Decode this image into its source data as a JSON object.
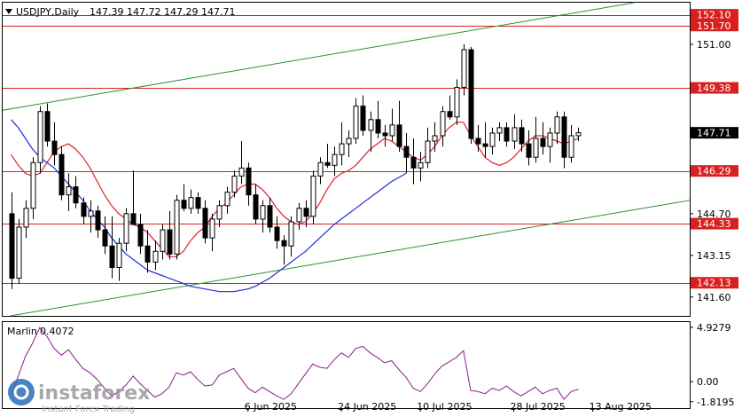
{
  "header": {
    "symbol": "USDJPY,Daily",
    "ohlc": "147.39 147.72 147.29 147.71"
  },
  "indicator": {
    "name": "Marlin",
    "value": "0.4072"
  },
  "watermark": {
    "brand": "instaforex",
    "tagline": "Instant Forex Trading"
  },
  "colors": {
    "bull_body": "#ffffff",
    "bear_body": "#000000",
    "candle_outline": "#000000",
    "ma_fast": "#e0202a",
    "ma_slow": "#1c2fd6",
    "channel": "#2f8f2f",
    "hline": "#d92020",
    "hlabel_bg": "#d92020",
    "osc": "#8b1f8b"
  },
  "chart_data": [
    {
      "type": "candlestick",
      "title": "USDJPY,Daily",
      "ylim": [
        140.9,
        152.55
      ],
      "y_ticks": [
        "151.00",
        "149.38",
        "147.71",
        "146.29",
        "144.70",
        "144.33",
        "143.15",
        "142.13",
        "141.60"
      ],
      "x_ticks": [
        "6 Jun 2025",
        "24 Jun 2025",
        "10 Jul 2025",
        "28 Jul 2025",
        "13 Aug 2025"
      ],
      "x_tick_bars": [
        33,
        46,
        57,
        70,
        81
      ],
      "price_label": "147.71",
      "horizontal_levels": [
        {
          "value": 152.1,
          "label": "152.10"
        },
        {
          "value": 151.7,
          "label": "151.70"
        },
        {
          "value": 149.38,
          "label": "149.38"
        },
        {
          "value": 146.29,
          "label": "146.29"
        },
        {
          "value": 144.33,
          "label": "144.33"
        },
        {
          "value": 142.13,
          "label": "142.13"
        }
      ],
      "channel_lines": [
        {
          "start": [
            0,
            148.6
          ],
          "end": [
            78,
            152.15
          ]
        },
        {
          "start": [
            12,
            141.45
          ],
          "end": [
            110,
            145.9
          ]
        }
      ],
      "candles": [
        [
          144.7,
          145.5,
          141.9,
          142.3
        ],
        [
          142.3,
          144.5,
          142.1,
          144.2
        ],
        [
          144.2,
          145.2,
          143.8,
          144.9
        ],
        [
          144.9,
          146.8,
          144.5,
          146.6
        ],
        [
          146.6,
          148.7,
          146.2,
          148.5
        ],
        [
          148.5,
          148.8,
          147.2,
          147.4
        ],
        [
          147.4,
          148.1,
          146.5,
          146.9
        ],
        [
          146.9,
          147.2,
          145.2,
          145.4
        ],
        [
          145.4,
          146.2,
          144.8,
          145.7
        ],
        [
          145.7,
          146.1,
          144.9,
          145.1
        ],
        [
          145.1,
          145.3,
          144.3,
          144.6
        ],
        [
          144.6,
          145.2,
          144.0,
          144.8
        ],
        [
          144.8,
          145.0,
          143.8,
          144.1
        ],
        [
          144.1,
          144.6,
          143.2,
          143.5
        ],
        [
          143.5,
          144.6,
          142.3,
          142.7
        ],
        [
          142.7,
          143.8,
          142.2,
          143.6
        ],
        [
          143.6,
          144.9,
          143.3,
          144.7
        ],
        [
          144.7,
          146.3,
          144.4,
          144.3
        ],
        [
          144.3,
          144.7,
          143.2,
          143.5
        ],
        [
          143.5,
          144.1,
          142.5,
          142.9
        ],
        [
          142.9,
          143.7,
          142.6,
          143.3
        ],
        [
          143.3,
          144.3,
          143.0,
          144.1
        ],
        [
          144.1,
          144.8,
          143.0,
          143.2
        ],
        [
          143.2,
          145.4,
          143.0,
          145.2
        ],
        [
          145.2,
          145.8,
          144.8,
          144.9
        ],
        [
          144.9,
          145.6,
          144.7,
          145.3
        ],
        [
          145.3,
          145.5,
          144.7,
          144.9
        ],
        [
          144.9,
          145.2,
          143.6,
          143.8
        ],
        [
          143.8,
          144.7,
          143.3,
          144.5
        ],
        [
          144.5,
          145.2,
          144.2,
          145.0
        ],
        [
          145.0,
          145.7,
          144.7,
          145.5
        ],
        [
          145.5,
          146.3,
          145.3,
          146.1
        ],
        [
          146.1,
          147.4,
          145.8,
          146.4
        ],
        [
          146.4,
          146.6,
          145.0,
          145.4
        ],
        [
          145.4,
          145.8,
          144.3,
          144.5
        ],
        [
          144.5,
          145.2,
          144.0,
          145.0
        ],
        [
          145.0,
          145.3,
          144.0,
          144.2
        ],
        [
          144.2,
          144.6,
          143.4,
          143.7
        ],
        [
          143.7,
          143.9,
          142.8,
          143.5
        ],
        [
          143.5,
          144.6,
          143.1,
          144.4
        ],
        [
          144.4,
          145.1,
          144.1,
          144.9
        ],
        [
          144.9,
          145.2,
          144.2,
          144.6
        ],
        [
          144.6,
          146.3,
          144.3,
          146.1
        ],
        [
          146.1,
          146.8,
          145.8,
          146.6
        ],
        [
          146.6,
          147.3,
          146.4,
          146.5
        ],
        [
          146.5,
          147.2,
          146.1,
          146.9
        ],
        [
          146.9,
          148.1,
          146.5,
          147.3
        ],
        [
          147.3,
          147.8,
          146.8,
          147.5
        ],
        [
          147.5,
          149.0,
          147.3,
          148.7
        ],
        [
          148.7,
          149.1,
          147.6,
          147.8
        ],
        [
          147.8,
          148.5,
          147.0,
          148.2
        ],
        [
          148.2,
          148.9,
          147.5,
          147.7
        ],
        [
          147.7,
          148.0,
          147.2,
          147.6
        ],
        [
          147.6,
          148.6,
          147.4,
          148.0
        ],
        [
          148.0,
          148.9,
          147.0,
          147.2
        ],
        [
          147.2,
          147.7,
          146.2,
          146.8
        ],
        [
          146.8,
          147.5,
          145.8,
          146.4
        ],
        [
          146.4,
          147.0,
          145.9,
          146.6
        ],
        [
          146.6,
          147.9,
          146.4,
          147.4
        ],
        [
          147.4,
          148.1,
          147.0,
          147.6
        ],
        [
          147.6,
          148.7,
          147.2,
          148.5
        ],
        [
          148.5,
          149.1,
          148.2,
          148.3
        ],
        [
          148.3,
          149.7,
          148.0,
          149.4
        ],
        [
          149.4,
          151.0,
          149.1,
          150.8
        ],
        [
          150.8,
          150.9,
          147.3,
          147.5
        ],
        [
          147.5,
          148.0,
          147.0,
          147.3
        ],
        [
          147.3,
          148.1,
          146.8,
          147.2
        ],
        [
          147.2,
          147.9,
          146.9,
          147.7
        ],
        [
          147.7,
          148.1,
          147.4,
          147.9
        ],
        [
          147.9,
          148.1,
          147.2,
          147.4
        ],
        [
          147.4,
          148.4,
          147.1,
          147.9
        ],
        [
          147.9,
          148.2,
          147.0,
          147.3
        ],
        [
          147.3,
          147.8,
          146.5,
          146.8
        ],
        [
          146.8,
          148.3,
          146.6,
          147.5
        ],
        [
          147.5,
          148.1,
          146.9,
          147.2
        ],
        [
          147.2,
          147.9,
          146.6,
          147.7
        ],
        [
          147.7,
          148.5,
          147.3,
          148.3
        ],
        [
          148.3,
          148.5,
          146.4,
          146.8
        ],
        [
          146.8,
          148.0,
          146.6,
          147.6
        ],
        [
          147.6,
          147.9,
          147.4,
          147.71
        ]
      ],
      "series": [
        {
          "name": "ma_fast",
          "values": [
            146.9,
            146.5,
            146.2,
            146.1,
            146.2,
            146.6,
            147.0,
            147.2,
            147.3,
            147.1,
            146.8,
            146.4,
            145.9,
            145.4,
            145.0,
            144.7,
            144.5,
            144.3,
            144.2,
            144.0,
            143.7,
            143.4,
            143.1,
            143.1,
            143.3,
            143.7,
            144.0,
            144.2,
            144.6,
            144.9,
            145.1,
            145.4,
            145.7,
            145.8,
            145.8,
            145.6,
            145.3,
            144.9,
            144.6,
            144.4,
            144.3,
            144.4,
            144.7,
            145.1,
            145.6,
            146.0,
            146.2,
            146.3,
            146.5,
            146.8,
            147.1,
            147.3,
            147.5,
            147.4,
            147.2,
            147.0,
            146.8,
            146.7,
            146.9,
            147.2,
            147.6,
            147.9,
            148.1,
            148.1,
            147.6,
            147.2,
            146.8,
            146.6,
            146.5,
            146.6,
            146.8,
            147.1,
            147.4,
            147.6,
            147.6,
            147.5,
            147.4,
            147.3,
            147.4,
            147.5
          ]
        },
        {
          "name": "ma_slow",
          "values": [
            148.2,
            147.9,
            147.5,
            147.1,
            146.8,
            146.6,
            146.4,
            146.1,
            145.8,
            145.5,
            145.2,
            144.8,
            144.5,
            144.2,
            143.8,
            143.5,
            143.2,
            143.0,
            142.8,
            142.6,
            142.5,
            142.4,
            142.3,
            142.2,
            142.1,
            142.0,
            141.95,
            141.9,
            141.85,
            141.8,
            141.8,
            141.8,
            141.85,
            141.9,
            142.0,
            142.15,
            142.3,
            142.5,
            142.7,
            142.9,
            143.1,
            143.3,
            143.55,
            143.8,
            144.05,
            144.3,
            144.5,
            144.7,
            144.9,
            145.1,
            145.3,
            145.5,
            145.7,
            145.9,
            146.05,
            146.2
          ]
        }
      ]
    },
    {
      "type": "line",
      "title": "Marlin 0.4072",
      "ylim": [
        -2.4,
        5.4
      ],
      "y_ticks": [
        "4.9279",
        "0.00",
        "-1.8195"
      ],
      "series": [
        {
          "name": "Marlin",
          "values": [
            -1.2,
            0.5,
            2.3,
            3.5,
            4.9,
            4.1,
            3.0,
            2.4,
            2.9,
            2.0,
            1.2,
            0.8,
            0.2,
            -0.6,
            -1.3,
            -0.9,
            -0.3,
            0.5,
            -0.2,
            -0.8,
            -1.4,
            -1.1,
            -0.5,
            0.8,
            0.6,
            0.9,
            0.2,
            -0.4,
            -0.3,
            0.6,
            0.9,
            1.2,
            0.3,
            -0.6,
            -1.0,
            -0.5,
            -0.9,
            -1.3,
            -1.6,
            -1.1,
            -0.2,
            0.7,
            1.6,
            1.3,
            1.2,
            2.0,
            2.6,
            2.2,
            3.0,
            3.2,
            2.6,
            2.2,
            1.7,
            1.9,
            1.1,
            0.4,
            -0.6,
            -0.9,
            -0.2,
            0.7,
            1.4,
            1.8,
            2.2,
            2.8,
            -0.8,
            -0.9,
            -1.1,
            -0.6,
            -0.8,
            -0.4,
            -0.9,
            -1.3,
            -0.9,
            -0.5,
            -1.1,
            -0.8,
            -0.6,
            -1.6,
            -0.9,
            -0.7
          ]
        }
      ]
    }
  ]
}
